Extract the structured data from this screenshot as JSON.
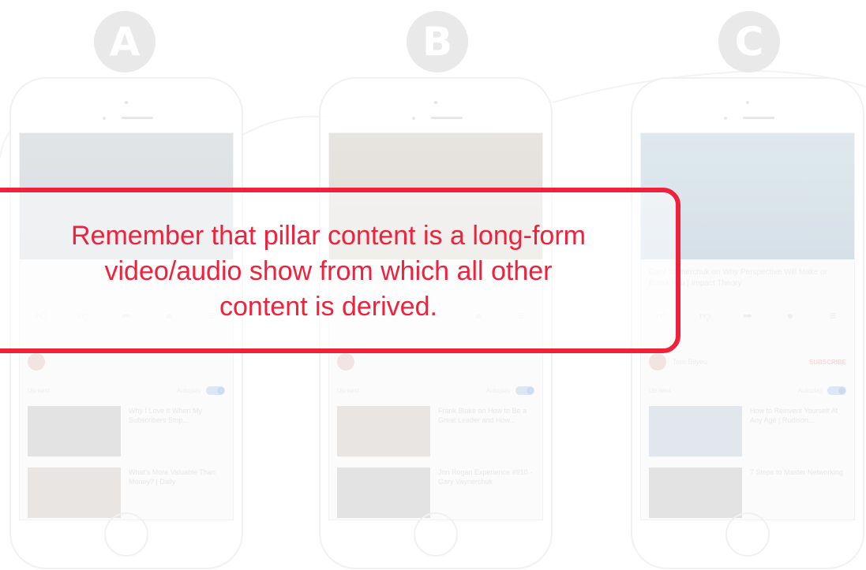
{
  "badges": [
    "A",
    "B",
    "C"
  ],
  "phones": [
    {
      "video_title": "",
      "views": "",
      "actions": [
        "",
        "",
        "",
        "",
        ""
      ],
      "channel_name": "",
      "subscribe_label": "",
      "up_next_label": "Up next",
      "autoplay_label": "Autoplay",
      "recommendations": [
        {
          "title": "Why I Love It When My Subscribers Stop...",
          "meta": ""
        },
        {
          "title": "What's More Valuable Than Money? | Daily",
          "meta": ""
        }
      ]
    },
    {
      "video_title": "",
      "views": "",
      "actions": [
        "",
        "",
        "",
        "",
        ""
      ],
      "channel_name": "",
      "subscribe_label": "",
      "up_next_label": "Up next",
      "autoplay_label": "Autoplay",
      "recommendations": [
        {
          "title": "Frank Blake on How to Be a Great Leader and How...",
          "meta": ""
        },
        {
          "title": "Jon Rogan Experience #910 - Gary Vaynerchuk",
          "meta": ""
        }
      ]
    },
    {
      "video_title": "Gary Vaynerchuk on Why Perspective Will Make or Break You | Impact Theory",
      "views": "",
      "actions": [
        "",
        "",
        "",
        "",
        ""
      ],
      "channel_name": "Tom Bilyeu",
      "subscribe_label": "SUBSCRIBE",
      "up_next_label": "Up next",
      "autoplay_label": "Autoplay",
      "recommendations": [
        {
          "title": "How to Reinvent Yourself At Any Age | Rudison...",
          "meta": ""
        },
        {
          "title": "7 Steps to Master Networking",
          "meta": ""
        }
      ]
    }
  ],
  "callout": {
    "text": "Remember that pillar content is a long-form\nvideo/audio show from which all other\ncontent is derived.",
    "color": "#f0213a"
  }
}
